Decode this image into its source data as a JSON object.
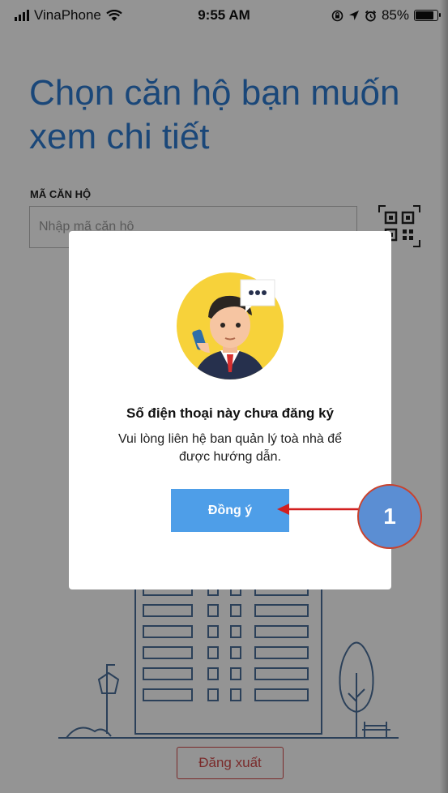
{
  "status_bar": {
    "carrier": "VinaPhone",
    "time": "9:55 AM",
    "battery": "85%",
    "battery_level": 0.85
  },
  "page": {
    "title": "Chọn căn hộ bạn muốn xem chi tiết",
    "field_label": "MÃ CĂN HỘ",
    "input_placeholder": "Nhập mã căn hộ",
    "input_value": "",
    "logout_label": "Đăng xuất"
  },
  "dialog": {
    "title": "Số điện thoại này chưa đăng ký",
    "message": "Vui lòng liên hệ ban quản lý toà nhà để được hướng dẫn.",
    "button_label": "Đồng ý"
  },
  "annotation": {
    "step": "1"
  },
  "colors": {
    "accent": "#2e7bd0",
    "button": "#4e9ee8",
    "danger": "#d24a4a",
    "annotation_fill": "#5b8ed3",
    "annotation_arrow": "#d21f1f"
  }
}
